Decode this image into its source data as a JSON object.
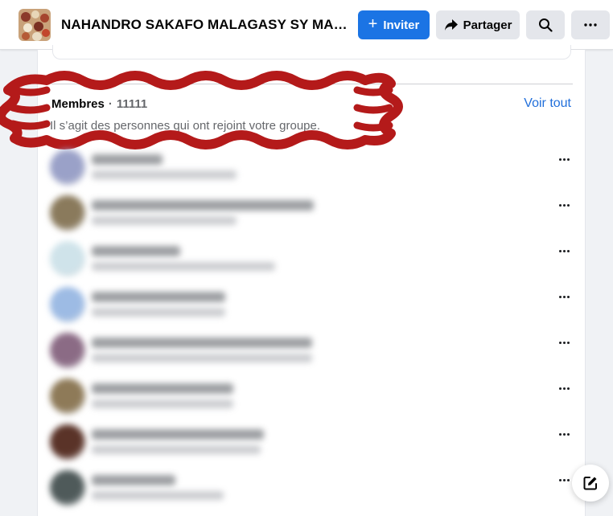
{
  "header": {
    "group_title": "NAHANDRO SAKAFO MALAGASY SY MANE...",
    "invite_label": "Inviter",
    "share_label": "Partager",
    "icons": {
      "invite": "plus-icon",
      "share": "share-arrow-icon",
      "search": "search-icon",
      "more": "more-horizontal-icon"
    }
  },
  "members": {
    "heading": "Membres",
    "separator": "·",
    "count": "11111",
    "description": "Il s’agit des personnes qui ont rejoint votre groupe.",
    "see_all_label": "Voir tout",
    "annotation_color": "#b41a1a",
    "rows": [
      {
        "avatar_color": "#9aa1c8",
        "blurred": true
      },
      {
        "avatar_color": "#8a7a5c",
        "blurred": true
      },
      {
        "avatar_color": "#cfe3ea",
        "blurred": true
      },
      {
        "avatar_color": "#9dbbe4",
        "blurred": true
      },
      {
        "avatar_color": "#8b6b85",
        "blurred": true
      },
      {
        "avatar_color": "#8e7a58",
        "blurred": true
      },
      {
        "avatar_color": "#5a3328",
        "blurred": true
      },
      {
        "avatar_color": "#4f5a5a",
        "blurred": true
      }
    ]
  },
  "floating": {
    "compose_icon": "compose-icon"
  },
  "colors": {
    "primary": "#1b74e4",
    "link": "#216fdb",
    "secondary_button": "#e4e6eb",
    "muted_text": "#65676b"
  }
}
